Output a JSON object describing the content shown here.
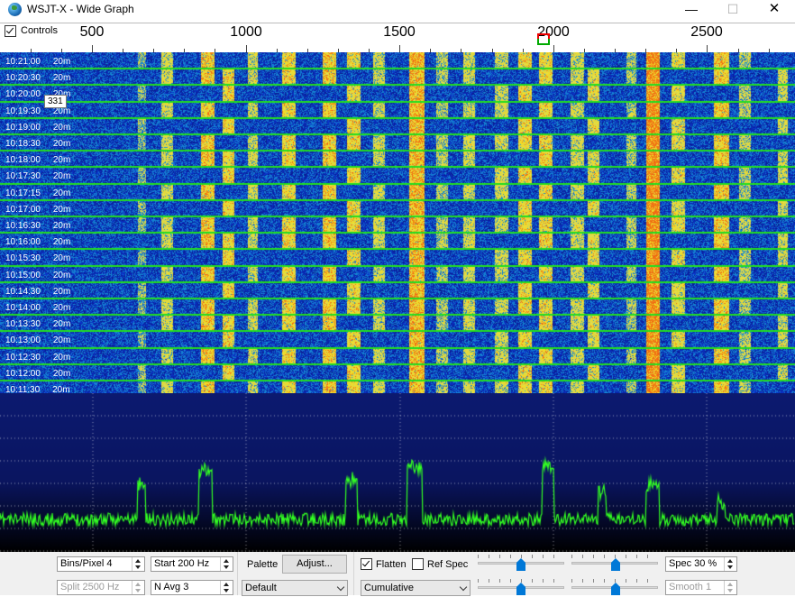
{
  "window": {
    "title": "WSJT-X - Wide Graph",
    "minimize": "—",
    "maximize": "☐",
    "close": "✕"
  },
  "ruler": {
    "controls_label": "Controls",
    "controls_checked": true,
    "labels": [
      "500",
      "1000",
      "1500",
      "2000",
      "2500"
    ]
  },
  "waterfall": {
    "tooltip": "331",
    "rows": [
      {
        "time": "10:21:00",
        "band": "20m"
      },
      {
        "time": "10:20:30",
        "band": "20m"
      },
      {
        "time": "10:20:00",
        "band": "20m"
      },
      {
        "time": "10:19:30",
        "band": "20m"
      },
      {
        "time": "10:19:00",
        "band": "20m"
      },
      {
        "time": "10:18:30",
        "band": "20m"
      },
      {
        "time": "10:18:00",
        "band": "20m"
      },
      {
        "time": "10:17:30",
        "band": "20m"
      },
      {
        "time": "10:17:15",
        "band": "20m"
      },
      {
        "time": "10:17:00",
        "band": "20m"
      },
      {
        "time": "10:16:30",
        "band": "20m"
      },
      {
        "time": "10:16:00",
        "band": "20m"
      },
      {
        "time": "10:15:30",
        "band": "20m"
      },
      {
        "time": "10:15:00",
        "band": "20m"
      },
      {
        "time": "10:14:30",
        "band": "20m"
      },
      {
        "time": "10:14:00",
        "band": "20m"
      },
      {
        "time": "10:13:30",
        "band": "20m"
      },
      {
        "time": "10:13:00",
        "band": "20m"
      },
      {
        "time": "10:12:30",
        "band": "20m"
      },
      {
        "time": "10:12:00",
        "band": "20m"
      },
      {
        "time": "10:11:30",
        "band": "20m"
      }
    ]
  },
  "controls": {
    "bins_per_pixel": "Bins/Pixel  4",
    "start": "Start 200 Hz",
    "split": "Split  2500  Hz",
    "n_avg": "N Avg 3",
    "palette_label": "Palette",
    "adjust_button": "Adjust...",
    "palette_value": "Default",
    "flatten_label": "Flatten",
    "flatten_checked": true,
    "ref_spec_label": "Ref Spec",
    "ref_spec_checked": false,
    "mode_value": "Cumulative",
    "spec_value": "Spec 30 %",
    "smooth_value": "Smooth  1"
  },
  "colors": {
    "waterfall_bg": "#0a1a8a",
    "row_separator": "#22dd22",
    "spectrum_line": "#33ff22",
    "spectrum_top": "#0c1666",
    "spectrum_bottom": "#000000",
    "slider_thumb": "#0078d7"
  }
}
